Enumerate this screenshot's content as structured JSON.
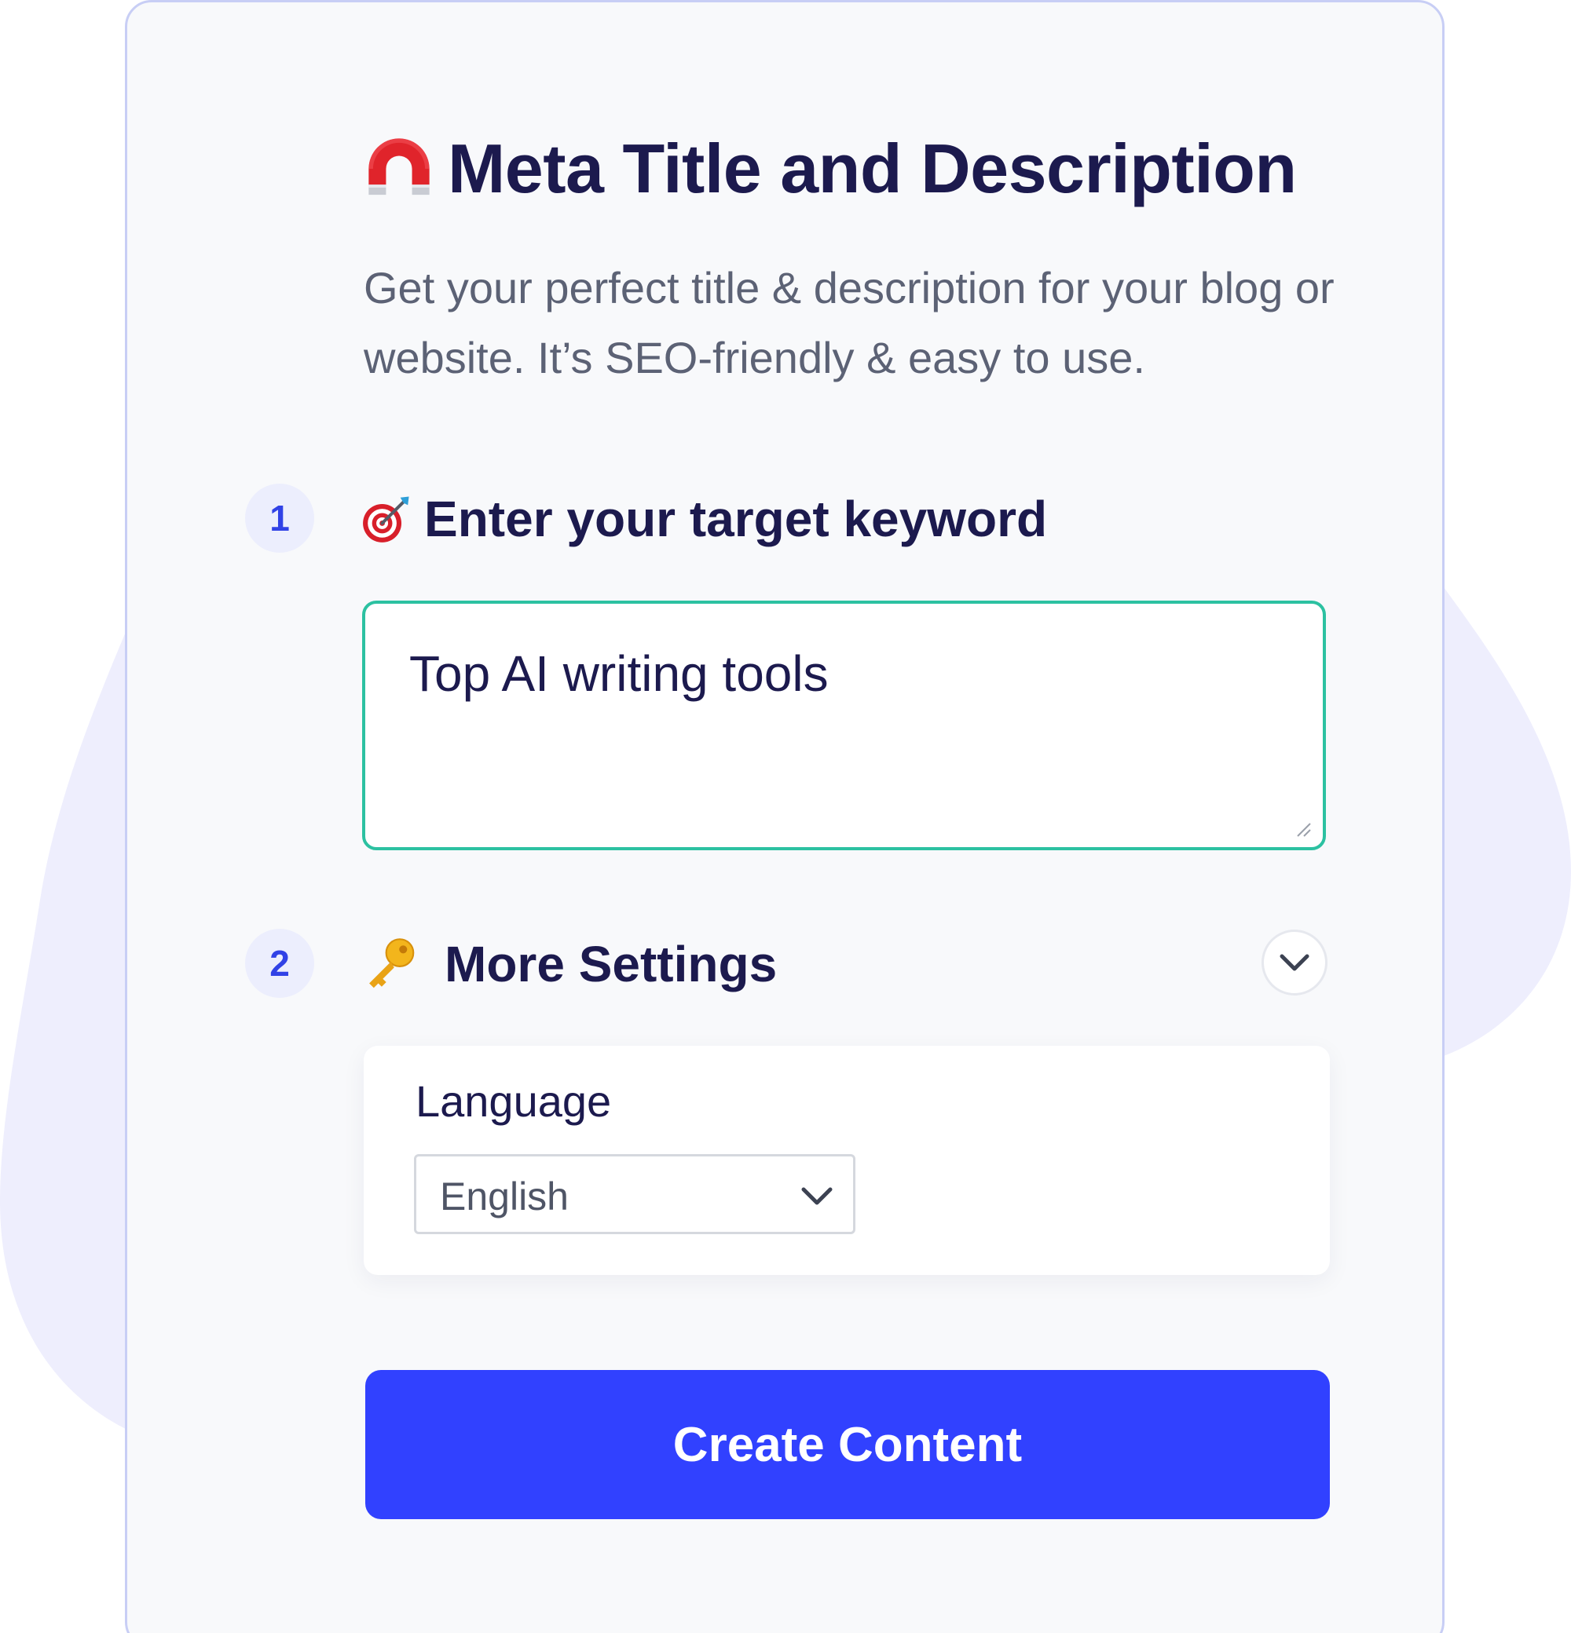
{
  "header": {
    "title": "Meta Title and Description",
    "icon": "magnet-icon",
    "subtitle": "Get your perfect title & description for your blog or website. It’s SEO-friendly & easy to use."
  },
  "steps": [
    {
      "number": "1",
      "icon": "target-dart-icon",
      "title": "Enter your target keyword",
      "input_value": "Top AI writing tools"
    },
    {
      "number": "2",
      "icon": "key-icon",
      "title": "More Settings",
      "expanded": true,
      "language_label": "Language",
      "language_value": "English"
    }
  ],
  "actions": {
    "create_label": "Create Content"
  },
  "colors": {
    "accent": "#3141FF",
    "input_focus_border": "#2CC1A1",
    "title_text": "#1C1A4E",
    "step_badge_bg": "#ECEEFD",
    "step_badge_text": "#3142E6",
    "background_blob": "#EEEEFD",
    "card_border": "#C8CEF5"
  }
}
